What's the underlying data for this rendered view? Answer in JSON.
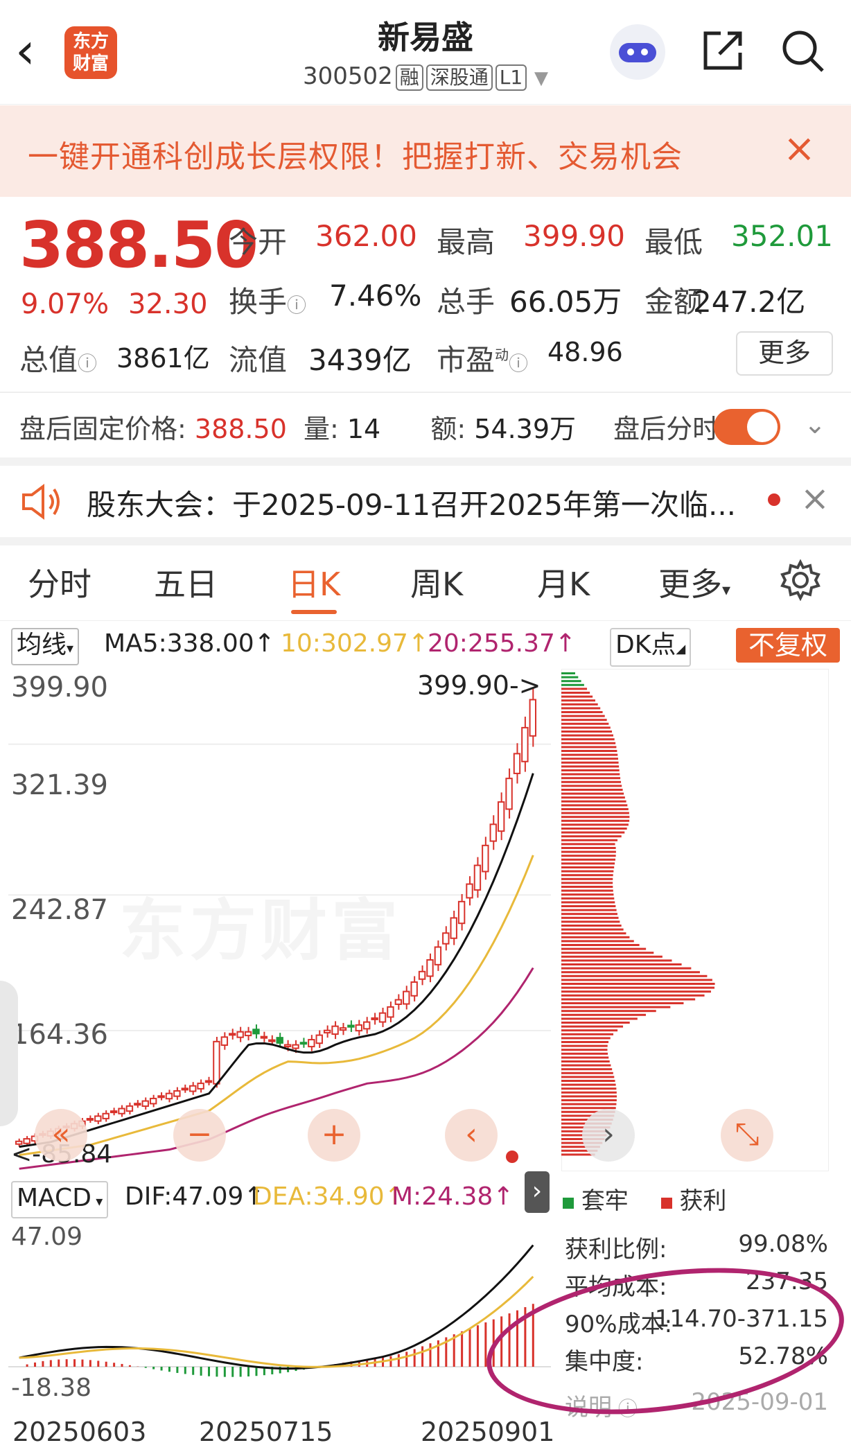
{
  "header": {
    "back_icon": "chevron-left-icon",
    "logo_text": "东方财富",
    "stock_name": "新易盛",
    "stock_code": "300502",
    "tags": [
      "融",
      "深股通",
      "L1"
    ]
  },
  "banner": {
    "text": "一键开通科创成长层权限！把握打新、交易机会",
    "close": "×"
  },
  "quote": {
    "price": "388.50",
    "change_pct": "9.07%",
    "change": "32.30",
    "open_label": "今开",
    "open": "362.00",
    "high_label": "最高",
    "high": "399.90",
    "low_label": "最低",
    "low": "352.01",
    "turnover_label": "换手",
    "turnover": "7.46%",
    "volume_label": "总手",
    "volume": "66.05万",
    "amount_label": "金额",
    "amount": "247.2亿",
    "mktcap_label": "总值",
    "mktcap": "3861亿",
    "float_label": "流值",
    "float_cap": "3439亿",
    "pe_label": "市盈",
    "pe_sup": "动",
    "pe": "48.96",
    "more": "更多"
  },
  "after_hours": {
    "price_label": "盘后固定价格:",
    "price": "388.50",
    "vol_label": "量:",
    "vol": "14",
    "amt_label": "额:",
    "amt": "54.39万",
    "toggle_label": "盘后分时"
  },
  "announcement": {
    "text": "股东大会：于2025-09-11召开2025年第一次临...",
    "close": "×"
  },
  "tabs": [
    "分时",
    "五日",
    "日K",
    "周K",
    "月K",
    "更多"
  ],
  "active_tab": "日K",
  "ma_bar": {
    "selector": "均线",
    "ma5": "MA5:338.00↑",
    "ma10": "10:302.97↑",
    "ma20": "20:255.37↑",
    "dk": "DK点",
    "adjust": "不复权"
  },
  "kchart": {
    "y_labels": [
      "399.90",
      "321.39",
      "242.87",
      "164.36",
      "85.84"
    ],
    "high_marker": "399.90->",
    "low_marker": "<-85.84",
    "watermark": "东方财富"
  },
  "macd_bar": {
    "selector": "MACD",
    "dif": "DIF:47.09↑",
    "dea": "DEA:34.90↑",
    "m": "M:24.38↑"
  },
  "macd": {
    "y_top": "47.09",
    "y_bottom": "-18.38"
  },
  "dates": [
    "20250603",
    "20250715",
    "20250901"
  ],
  "chip": {
    "legend_trapped": "套牢",
    "legend_profit": "获利",
    "stats": [
      {
        "label": "获利比例:",
        "value": "99.08%"
      },
      {
        "label": "平均成本:",
        "value": "237.35"
      },
      {
        "label": "90%成本:",
        "value": "114.70-371.15"
      },
      {
        "label": "集中度:",
        "value": "52.78%"
      }
    ],
    "footer_label": "说明",
    "footer_date": "2025-09-01"
  },
  "colors": {
    "up": "#d8322b",
    "down": "#1f9a3b",
    "accent": "#e9622f",
    "ma5": "#111111",
    "ma10": "#e8b93a",
    "ma20": "#b0246e"
  },
  "chart_data": {
    "type": "candlestick",
    "title": "",
    "ylim": [
      85.84,
      399.9
    ],
    "x_ticks": [
      "20250603",
      "20250715",
      "20250901"
    ],
    "last_close": 388.5,
    "ma": {
      "MA5": 338.0,
      "MA10": 302.97,
      "MA20": 255.37
    },
    "macd": {
      "DIF": 47.09,
      "DEA": 34.9,
      "M": 24.38,
      "ylim": [
        -18.38,
        47.09
      ]
    }
  }
}
